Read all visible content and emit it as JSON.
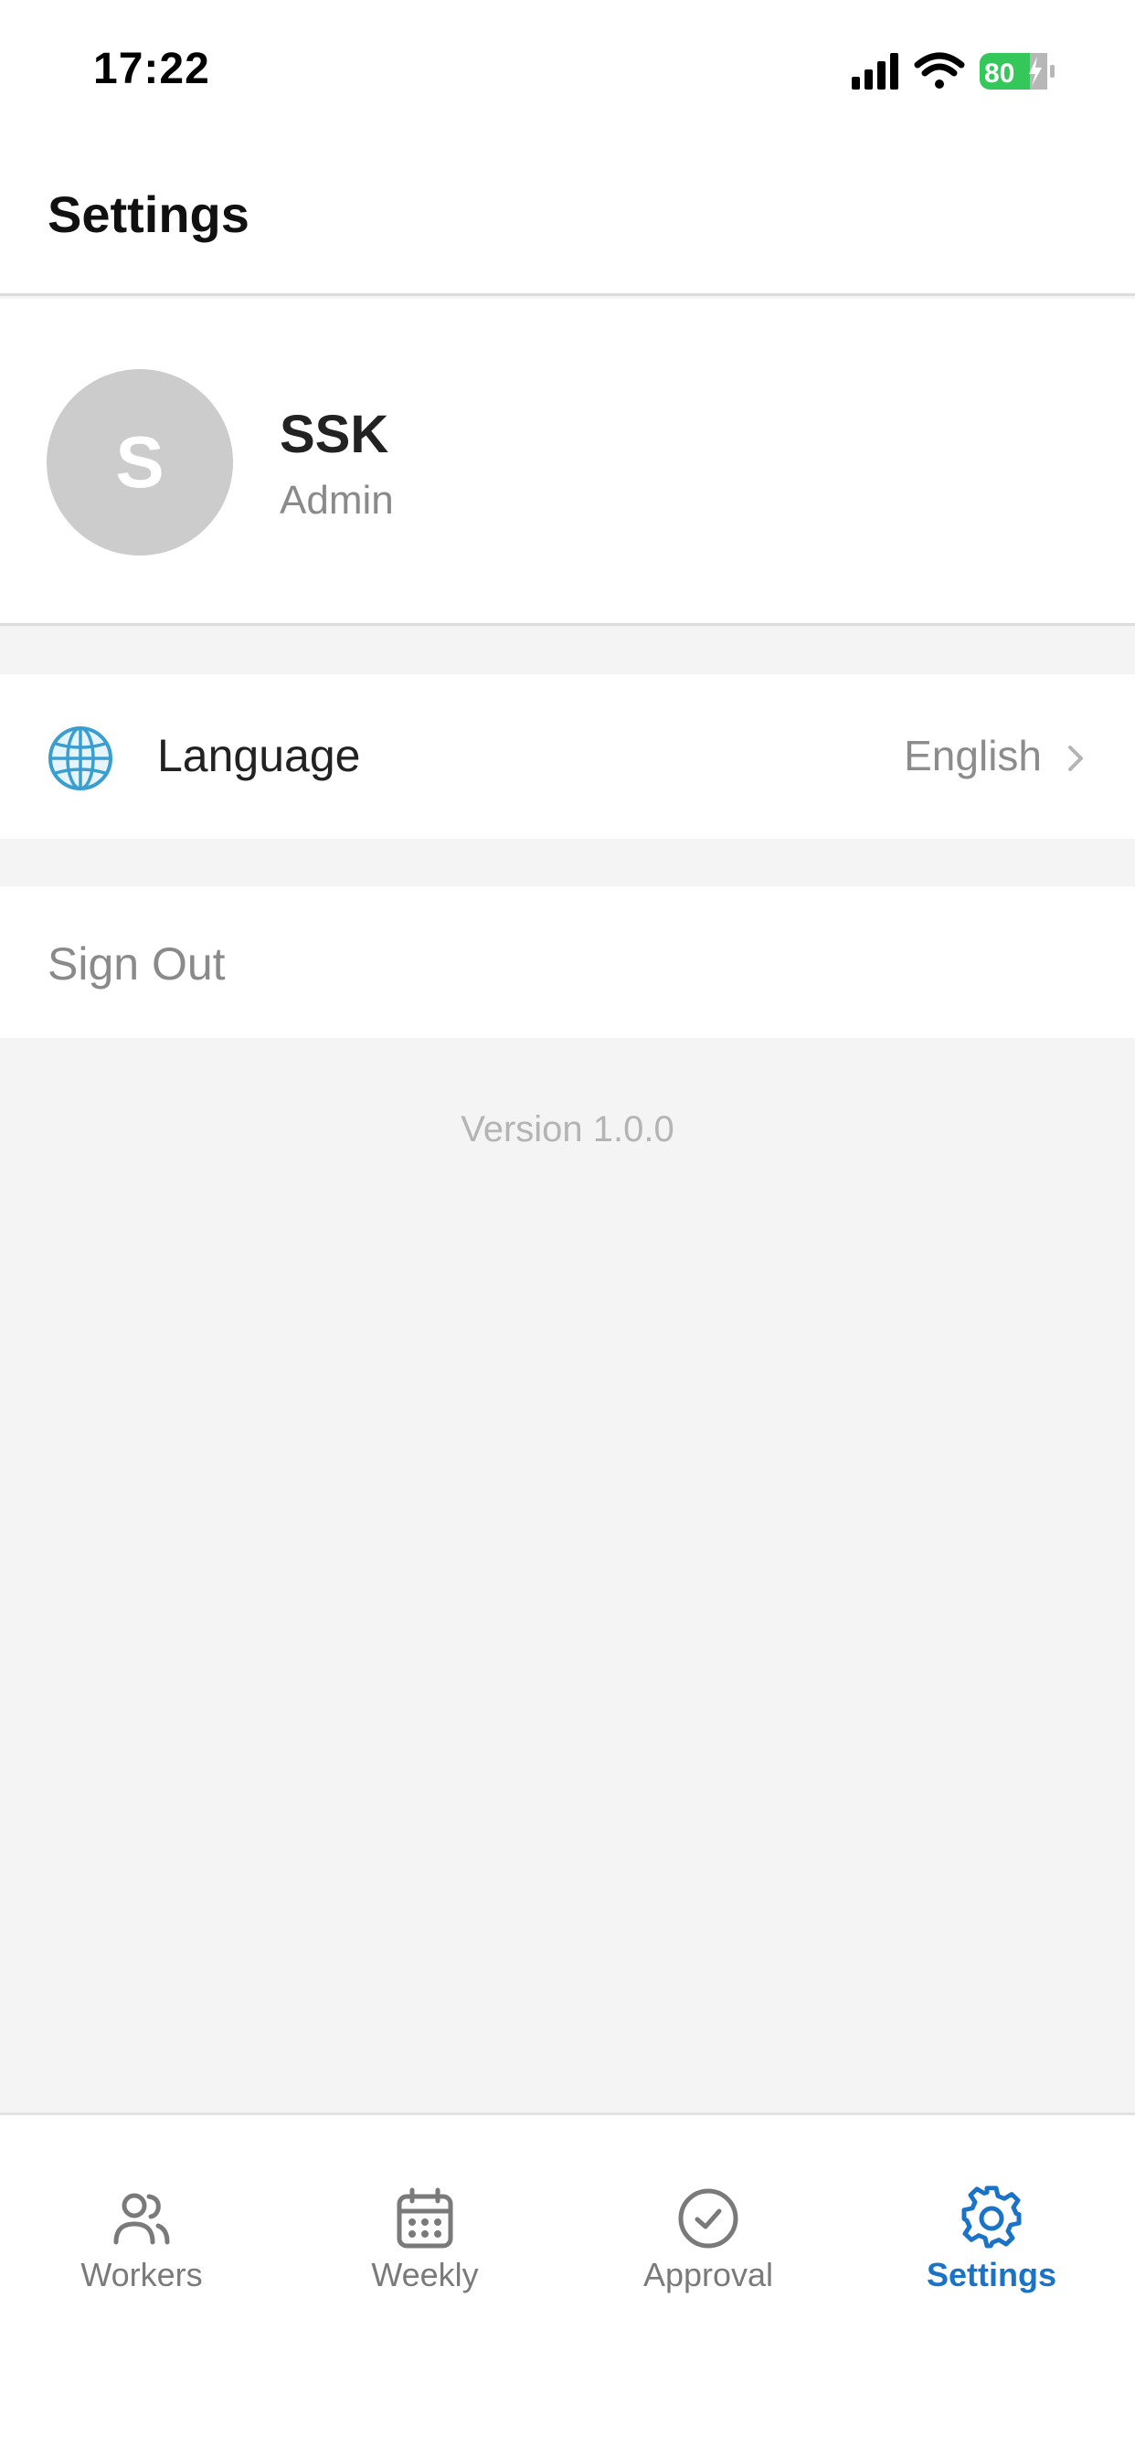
{
  "status_bar": {
    "time": "17:22",
    "battery": "80"
  },
  "header": {
    "title": "Settings"
  },
  "profile": {
    "avatar_initial": "S",
    "name": "SSK",
    "role": "Admin"
  },
  "settings": {
    "language": {
      "label": "Language",
      "value": "English",
      "icon": "globe-icon"
    },
    "sign_out_label": "Sign Out"
  },
  "version": "Version 1.0.0",
  "tab_bar": {
    "tabs": [
      {
        "label": "Workers",
        "icon": "workers-icon",
        "active": false
      },
      {
        "label": "Weekly",
        "icon": "calendar-icon",
        "active": false
      },
      {
        "label": "Approval",
        "icon": "check-circle-icon",
        "active": false
      },
      {
        "label": "Settings",
        "icon": "gear-icon",
        "active": true
      }
    ]
  },
  "colors": {
    "accent": "#1a73c7",
    "battery_green": "#34c759",
    "background": "#f4f4f4",
    "avatar_bg": "#cccccc"
  }
}
